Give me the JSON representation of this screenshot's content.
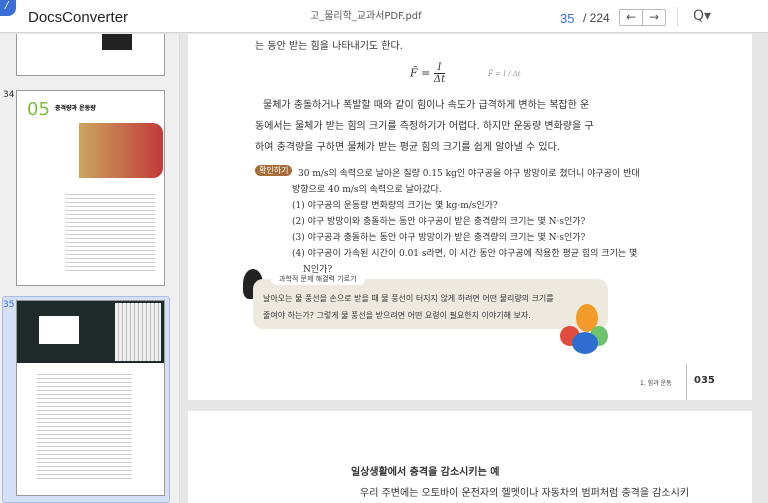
{
  "header": {
    "logo_glyph": "/",
    "app_title": "DocsConverter",
    "file_name": "고_물리학_교과서PDF.pdf",
    "current_page": "35",
    "total_pages": "/ 224",
    "prev_icon": "←",
    "next_icon": "→",
    "search_icon": "Q▾"
  },
  "sidebar": {
    "thumbnails": [
      {
        "number": "34"
      },
      {
        "number": "35"
      }
    ],
    "thumb34_title_num": "05",
    "thumb34_title": "충격량과 운동량"
  },
  "page": {
    "line_top": "는 동안 받는 힘을 나타내기도 한다.",
    "formula": "F̄ = I / Δt",
    "formula_lhs": "F̄ =",
    "formula_num": "I",
    "formula_den": "Δt",
    "para": [
      "물체가 충돌하거나 폭발할 때와 같이 힘이나 속도가 급격하게 변하는 복잡한 운",
      "동에서는 물체가 받는 힘의 크기를 측정하기가 어렵다. 하지만 운동량 변화량을 구",
      "하여 충격량을 구하면 물체가 받는 평균 힘의 크기를 쉽게 알아낼 수 있다."
    ],
    "check_tag": "확인하기",
    "check_lines": [
      "30 m/s의 속력으로 날아온 질량 0.15 kg인 야구공을 야구 방망이로 쳤더니 야구공이 반대",
      "방향으로 40 m/s의 속력으로 날아갔다.",
      "(1) 야구공의 운동량 변화량의 크기는 몇 kg·m/s인가?",
      "(2) 야구 방망이와 충돌하는 동안 야구공이 받은 충격량의 크기는 몇 N·s인가?",
      "(3) 야구공과 충돌하는 동안 야구 방망이가 받은 충격량의 크기는 몇 N·s인가?",
      "(4) 야구공이 가속된 시간이 0.01 s라면, 이 시간 동안 야구공에 작용한 평균 힘의 크기는 몇",
      "N인가?"
    ],
    "bubble_title": "과학적 문제 해결력 기르기",
    "bubble_lines": [
      "날아오는 물 풍선을 손으로 받을 때 물 풍선이 터지지 않게 하려면 어떤 물리량의 크기를",
      "줄여야 하는가? 그렇게 물 풍선을 받으려면 어떤 요령이 필요한지 이야기해 보자."
    ],
    "footer_chapter": "1. 힘과 운동",
    "footer_page": "035"
  },
  "next_page": {
    "heading": "일상생활에서 충격을 감소시키는 예",
    "line": "우리 주변에는 오토바이 운전자의 헬멧이나 자동차의 범퍼처럼 충격을 감소시키"
  }
}
